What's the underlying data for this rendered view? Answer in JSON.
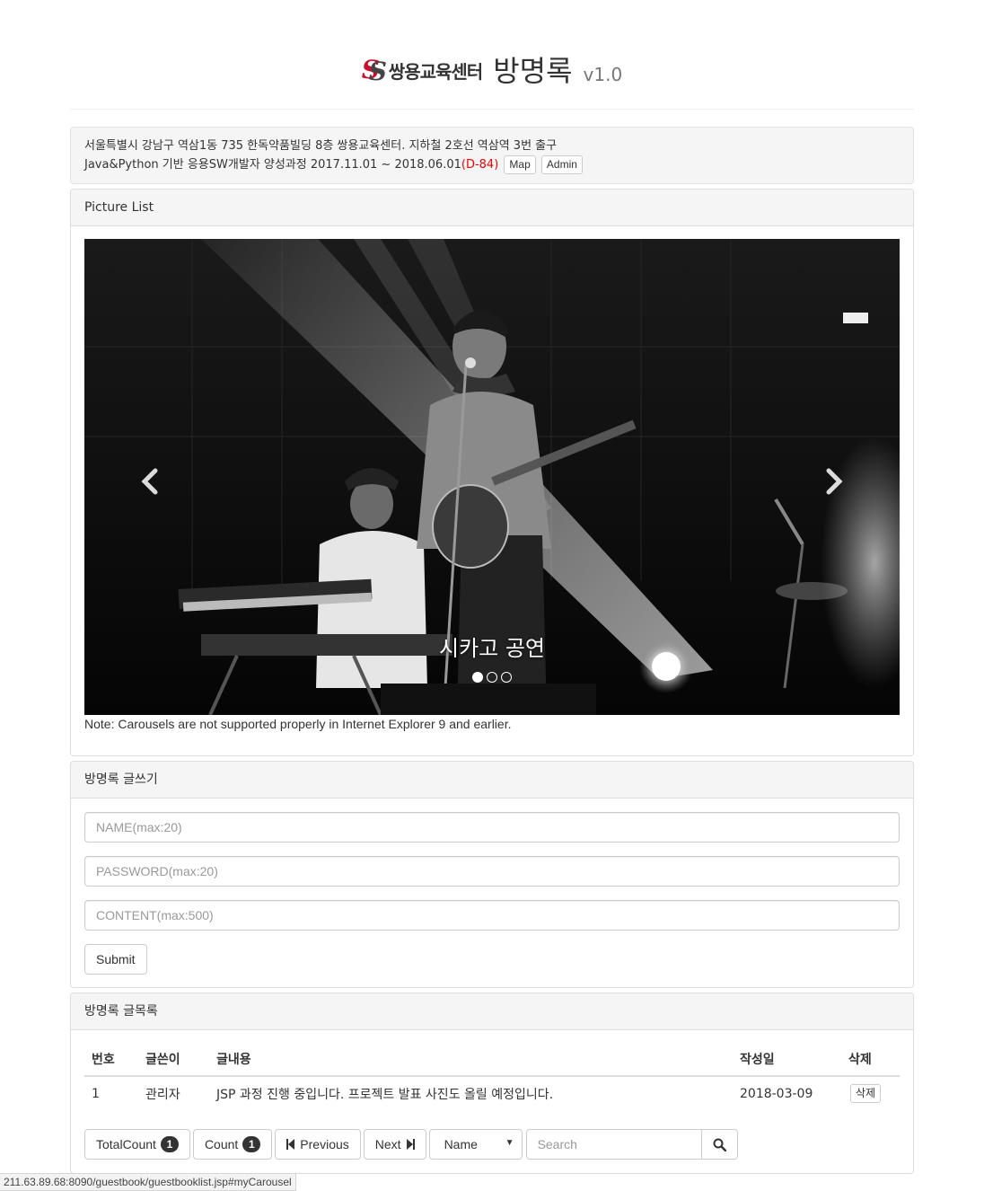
{
  "header": {
    "logo_text": "쌍용교육센터",
    "title": "방명록",
    "version": "v1.0"
  },
  "info": {
    "line1": "서울특별시 강남구 역삼1동 735 한독약품빌딩 8층 쌍용교육센터. 지하철 2호선 역삼역 3번 출구",
    "line2": "Java&Python 기반 응용SW개발자 양성과정 2017.11.01 ~ 2018.06.01",
    "dday": "(D-84)",
    "map_label": "Map",
    "admin_label": "Admin"
  },
  "picture_panel": {
    "heading": "Picture List",
    "caption": "시카고 공연",
    "note": "Note: Carousels are not supported properly in Internet Explorer 9 and earlier.",
    "slides": 3,
    "active_slide": 1
  },
  "write_panel": {
    "heading": "방명록 글쓰기",
    "name_placeholder": "NAME(max:20)",
    "password_placeholder": "PASSWORD(max:20)",
    "content_placeholder": "CONTENT(max:500)",
    "submit_label": "Submit"
  },
  "list_panel": {
    "heading": "방명록 글목록",
    "columns": [
      "번호",
      "글쓴이",
      "글내용",
      "작성일",
      "삭제"
    ],
    "rows": [
      {
        "no": "1",
        "writer": "관리자",
        "content": "JSP 과정 진행 중입니다. 프로젝트 발표 사진도 올릴 예정입니다.",
        "date": "2018-03-09",
        "delete_label": "삭제"
      }
    ],
    "total_count_label": "TotalCount",
    "total_count": "1",
    "count_label": "Count",
    "count": "1",
    "previous_label": "Previous",
    "next_label": "Next",
    "search_key": "Name",
    "search_placeholder": "Search"
  },
  "status_bar": "211.63.89.68:8090/guestbook/guestbooklist.jsp#myCarousel"
}
